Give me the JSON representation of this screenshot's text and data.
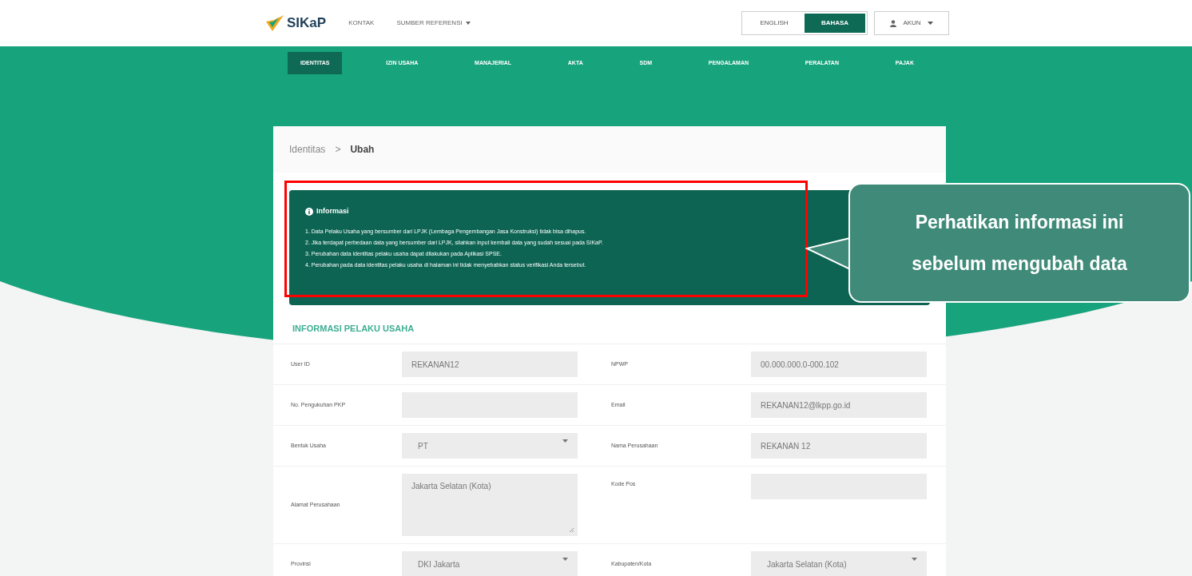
{
  "navbar": {
    "brand": "SIKaP",
    "links": [
      {
        "label": "KONTAK",
        "dropdown": false
      },
      {
        "label": "SUMBER REFERENSI",
        "dropdown": true
      }
    ],
    "languages": [
      {
        "label": "ENGLISH",
        "selected": false
      },
      {
        "label": "BAHASA",
        "selected": true
      }
    ],
    "account": "AKUN"
  },
  "tabs": [
    {
      "label": "IDENTITAS",
      "selected": true
    },
    {
      "label": "IZIN USAHA",
      "selected": false
    },
    {
      "label": "MANAJERIAL",
      "selected": false
    },
    {
      "label": "AKTA",
      "selected": false
    },
    {
      "label": "SDM",
      "selected": false
    },
    {
      "label": "PENGALAMAN",
      "selected": false
    },
    {
      "label": "PERALATAN",
      "selected": false
    },
    {
      "label": "PAJAK",
      "selected": false
    }
  ],
  "breadcrumb": {
    "parent": "Identitas",
    "separator": ">",
    "current": "Ubah"
  },
  "info": {
    "title": "Informasi",
    "items": [
      "1. Data Pelaku Usaha yang bersumber dari LPJK (Lembaga Pengembangan Jasa Konstruksi) tidak bisa dihapus.",
      "2. Jika terdapat perbedaan data yang bersumber dari LPJK, silahkan input kembali data yang sudah sesuai pada SIKaP.",
      "3. Perubahan data identitas pelaku usaha dapat dilakukan pada Aplikasi SPSE.",
      "4. Perubahan pada data identitas pelaku usaha di halaman ini tidak menyebabkan status verifikasi Anda tersebut."
    ]
  },
  "section_title": "INFORMASI PELAKU USAHA",
  "rows": [
    {
      "left": {
        "label": "User ID",
        "kind": "text",
        "value": "REKANAN12"
      },
      "right": {
        "label": "NPWP",
        "kind": "text",
        "value": "00.000.000.0-000.102"
      }
    },
    {
      "left": {
        "label": "No. Pengukuhan PKP",
        "kind": "text"
      },
      "right": {
        "label": "Email",
        "kind": "text",
        "value": "REKANAN12@lkpp.go.id"
      }
    },
    {
      "left": {
        "label": "Bentuk Usaha",
        "kind": "select",
        "value": "PT"
      },
      "right": {
        "label": "Nama Perusahaan",
        "kind": "text",
        "value": "REKANAN 12"
      }
    },
    {
      "left": {
        "label": "Alamat Perusahaan",
        "kind": "textarea",
        "value": "Jakarta Selatan (Kota)"
      },
      "right": {
        "label": "Kode Pos",
        "kind": "text"
      }
    },
    {
      "left": {
        "label": "Provinsi",
        "kind": "select",
        "value": "DKI Jakarta"
      },
      "right": {
        "label": "Kabupaten/Kota",
        "kind": "select",
        "value": "Jakarta Selatan (Kota)"
      }
    }
  ],
  "callout": {
    "lines": [
      "Perhatikan informasi ini",
      "sebelum mengubah data"
    ]
  }
}
